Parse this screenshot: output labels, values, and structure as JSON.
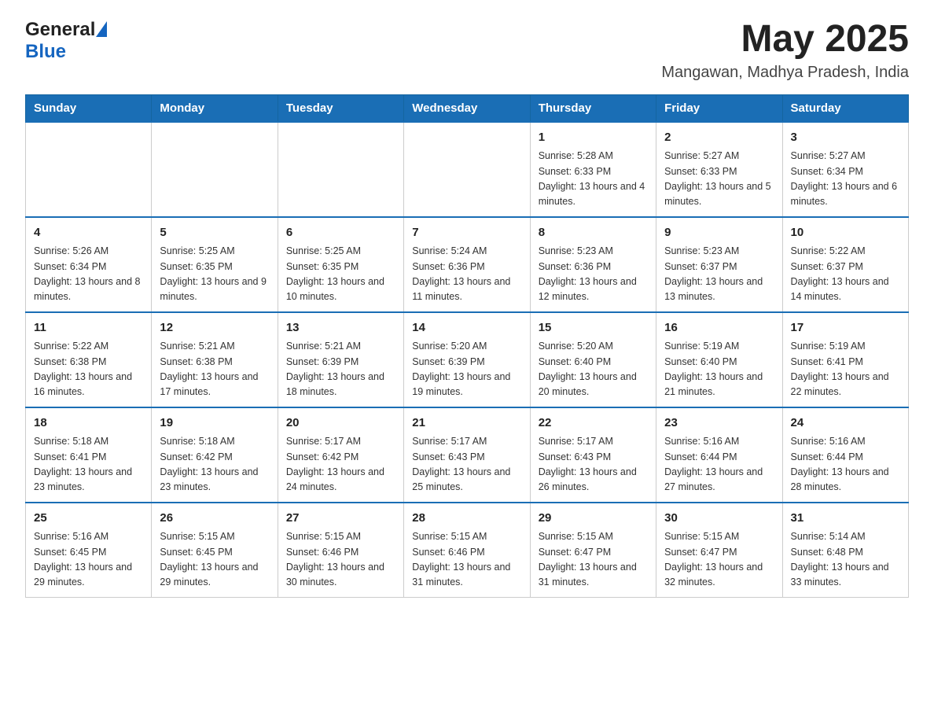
{
  "header": {
    "logo_general": "General",
    "logo_blue": "Blue",
    "month_year": "May 2025",
    "location": "Mangawan, Madhya Pradesh, India"
  },
  "days_of_week": [
    "Sunday",
    "Monday",
    "Tuesday",
    "Wednesday",
    "Thursday",
    "Friday",
    "Saturday"
  ],
  "weeks": [
    [
      {
        "day": "",
        "info": ""
      },
      {
        "day": "",
        "info": ""
      },
      {
        "day": "",
        "info": ""
      },
      {
        "day": "",
        "info": ""
      },
      {
        "day": "1",
        "info": "Sunrise: 5:28 AM\nSunset: 6:33 PM\nDaylight: 13 hours and 4 minutes."
      },
      {
        "day": "2",
        "info": "Sunrise: 5:27 AM\nSunset: 6:33 PM\nDaylight: 13 hours and 5 minutes."
      },
      {
        "day": "3",
        "info": "Sunrise: 5:27 AM\nSunset: 6:34 PM\nDaylight: 13 hours and 6 minutes."
      }
    ],
    [
      {
        "day": "4",
        "info": "Sunrise: 5:26 AM\nSunset: 6:34 PM\nDaylight: 13 hours and 8 minutes."
      },
      {
        "day": "5",
        "info": "Sunrise: 5:25 AM\nSunset: 6:35 PM\nDaylight: 13 hours and 9 minutes."
      },
      {
        "day": "6",
        "info": "Sunrise: 5:25 AM\nSunset: 6:35 PM\nDaylight: 13 hours and 10 minutes."
      },
      {
        "day": "7",
        "info": "Sunrise: 5:24 AM\nSunset: 6:36 PM\nDaylight: 13 hours and 11 minutes."
      },
      {
        "day": "8",
        "info": "Sunrise: 5:23 AM\nSunset: 6:36 PM\nDaylight: 13 hours and 12 minutes."
      },
      {
        "day": "9",
        "info": "Sunrise: 5:23 AM\nSunset: 6:37 PM\nDaylight: 13 hours and 13 minutes."
      },
      {
        "day": "10",
        "info": "Sunrise: 5:22 AM\nSunset: 6:37 PM\nDaylight: 13 hours and 14 minutes."
      }
    ],
    [
      {
        "day": "11",
        "info": "Sunrise: 5:22 AM\nSunset: 6:38 PM\nDaylight: 13 hours and 16 minutes."
      },
      {
        "day": "12",
        "info": "Sunrise: 5:21 AM\nSunset: 6:38 PM\nDaylight: 13 hours and 17 minutes."
      },
      {
        "day": "13",
        "info": "Sunrise: 5:21 AM\nSunset: 6:39 PM\nDaylight: 13 hours and 18 minutes."
      },
      {
        "day": "14",
        "info": "Sunrise: 5:20 AM\nSunset: 6:39 PM\nDaylight: 13 hours and 19 minutes."
      },
      {
        "day": "15",
        "info": "Sunrise: 5:20 AM\nSunset: 6:40 PM\nDaylight: 13 hours and 20 minutes."
      },
      {
        "day": "16",
        "info": "Sunrise: 5:19 AM\nSunset: 6:40 PM\nDaylight: 13 hours and 21 minutes."
      },
      {
        "day": "17",
        "info": "Sunrise: 5:19 AM\nSunset: 6:41 PM\nDaylight: 13 hours and 22 minutes."
      }
    ],
    [
      {
        "day": "18",
        "info": "Sunrise: 5:18 AM\nSunset: 6:41 PM\nDaylight: 13 hours and 23 minutes."
      },
      {
        "day": "19",
        "info": "Sunrise: 5:18 AM\nSunset: 6:42 PM\nDaylight: 13 hours and 23 minutes."
      },
      {
        "day": "20",
        "info": "Sunrise: 5:17 AM\nSunset: 6:42 PM\nDaylight: 13 hours and 24 minutes."
      },
      {
        "day": "21",
        "info": "Sunrise: 5:17 AM\nSunset: 6:43 PM\nDaylight: 13 hours and 25 minutes."
      },
      {
        "day": "22",
        "info": "Sunrise: 5:17 AM\nSunset: 6:43 PM\nDaylight: 13 hours and 26 minutes."
      },
      {
        "day": "23",
        "info": "Sunrise: 5:16 AM\nSunset: 6:44 PM\nDaylight: 13 hours and 27 minutes."
      },
      {
        "day": "24",
        "info": "Sunrise: 5:16 AM\nSunset: 6:44 PM\nDaylight: 13 hours and 28 minutes."
      }
    ],
    [
      {
        "day": "25",
        "info": "Sunrise: 5:16 AM\nSunset: 6:45 PM\nDaylight: 13 hours and 29 minutes."
      },
      {
        "day": "26",
        "info": "Sunrise: 5:15 AM\nSunset: 6:45 PM\nDaylight: 13 hours and 29 minutes."
      },
      {
        "day": "27",
        "info": "Sunrise: 5:15 AM\nSunset: 6:46 PM\nDaylight: 13 hours and 30 minutes."
      },
      {
        "day": "28",
        "info": "Sunrise: 5:15 AM\nSunset: 6:46 PM\nDaylight: 13 hours and 31 minutes."
      },
      {
        "day": "29",
        "info": "Sunrise: 5:15 AM\nSunset: 6:47 PM\nDaylight: 13 hours and 31 minutes."
      },
      {
        "day": "30",
        "info": "Sunrise: 5:15 AM\nSunset: 6:47 PM\nDaylight: 13 hours and 32 minutes."
      },
      {
        "day": "31",
        "info": "Sunrise: 5:14 AM\nSunset: 6:48 PM\nDaylight: 13 hours and 33 minutes."
      }
    ]
  ]
}
